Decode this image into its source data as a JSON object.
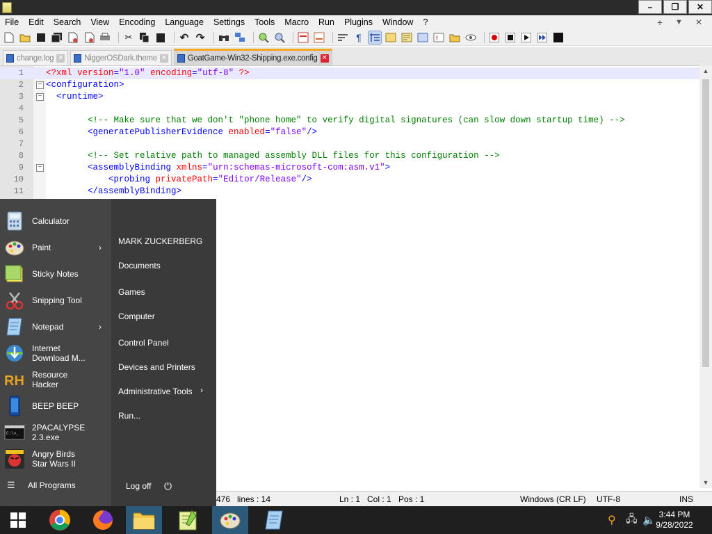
{
  "window": {
    "title": ""
  },
  "menubar": {
    "items": [
      "File",
      "Edit",
      "Search",
      "View",
      "Encoding",
      "Language",
      "Settings",
      "Tools",
      "Macro",
      "Run",
      "Plugins",
      "Window",
      "?"
    ],
    "right": [
      "+",
      "▼",
      "✕"
    ]
  },
  "window_buttons": {
    "minimize": "–",
    "restore": "❐",
    "close": "✕"
  },
  "tabs": [
    {
      "label": "change.log",
      "close": "✕"
    },
    {
      "label": "NiggerOSDark.theme",
      "close": "✕"
    },
    {
      "label": "GoatGame-Win32-Shipping.exe.config",
      "close": "✕"
    }
  ],
  "editor": {
    "lines": [
      {
        "n": "1",
        "fold": "",
        "seg": [
          [
            "pi",
            "<?xml "
          ],
          [
            "attr",
            "version"
          ],
          [
            "tag",
            "="
          ],
          [
            "val",
            "\"1.0\""
          ],
          [
            "attr",
            " encoding"
          ],
          [
            "tag",
            "="
          ],
          [
            "val",
            "\"utf-8\""
          ],
          [
            "pi",
            " ?>"
          ]
        ]
      },
      {
        "n": "2",
        "fold": "−",
        "seg": [
          [
            "tag",
            "<configuration>"
          ]
        ]
      },
      {
        "n": "3",
        "fold": "−",
        "seg": [
          [
            "tag",
            "  <runtime>"
          ]
        ]
      },
      {
        "n": "4",
        "fold": "",
        "seg": []
      },
      {
        "n": "5",
        "fold": "",
        "seg": [
          [
            "cmt",
            "        <!-- Make sure that we don't \"phone home\" to verify digital signatures (can slow down startup time) -->"
          ]
        ]
      },
      {
        "n": "6",
        "fold": "",
        "seg": [
          [
            "tag",
            "        <generatePublisherEvidence "
          ],
          [
            "attr",
            "enabled"
          ],
          [
            "tag",
            "="
          ],
          [
            "val",
            "\"false\""
          ],
          [
            "tag",
            "/>"
          ]
        ]
      },
      {
        "n": "7",
        "fold": "",
        "seg": []
      },
      {
        "n": "8",
        "fold": "",
        "seg": [
          [
            "cmt",
            "        <!-- Set relative path to managed assembly DLL files for this configuration -->"
          ]
        ]
      },
      {
        "n": "9",
        "fold": "−",
        "seg": [
          [
            "tag",
            "        <assemblyBinding "
          ],
          [
            "attr",
            "xmlns"
          ],
          [
            "tag",
            "="
          ],
          [
            "val",
            "\"urn:schemas-microsoft-com:asm.v1\""
          ],
          [
            "tag",
            ">"
          ]
        ]
      },
      {
        "n": "10",
        "fold": "",
        "seg": [
          [
            "tag",
            "            <probing "
          ],
          [
            "attr",
            "privatePath"
          ],
          [
            "tag",
            "="
          ],
          [
            "val",
            "\"Editor/Release\""
          ],
          [
            "tag",
            "/>"
          ]
        ]
      },
      {
        "n": "11",
        "fold": "",
        "seg": [
          [
            "tag",
            "        </assemblyBinding>"
          ]
        ]
      }
    ]
  },
  "statusbar": {
    "length": "476",
    "lines": "lines : 14",
    "ln": "Ln : 1",
    "col": "Col : 1",
    "pos": "Pos : 1",
    "eol": "Windows (CR LF)",
    "encoding": "UTF-8",
    "mode": "INS"
  },
  "startmenu": {
    "pinned": [
      {
        "label": "Calculator",
        "icon": "calculator-icon",
        "submenu": false
      },
      {
        "label": "Paint",
        "icon": "paint-icon",
        "submenu": true
      },
      {
        "label": "Sticky Notes",
        "icon": "sticky-notes-icon",
        "submenu": false
      },
      {
        "label": "Snipping Tool",
        "icon": "snipping-tool-icon",
        "submenu": false
      },
      {
        "label": "Notepad",
        "icon": "notepad-icon",
        "submenu": true
      },
      {
        "label": "Internet\nDownload M...",
        "icon": "idm-icon",
        "submenu": false
      },
      {
        "label": "Resource\nHacker",
        "icon": "resource-hacker-icon",
        "submenu": false
      },
      {
        "label": "BEEP BEEP",
        "icon": "phone-icon",
        "submenu": false
      },
      {
        "label": "2PACALYPSE\n2.3.exe",
        "icon": "console-icon",
        "submenu": false
      },
      {
        "label": "Angry Birds\nStar Wars II",
        "icon": "angry-birds-icon",
        "submenu": false
      }
    ],
    "all_programs": "All Programs",
    "places": [
      {
        "label": "MARK ZUCKERBERG",
        "submenu": false
      },
      {
        "label": "Documents",
        "submenu": false
      },
      {
        "label": "Games",
        "submenu": false
      },
      {
        "label": "Computer",
        "submenu": false
      },
      {
        "label": "Control Panel",
        "submenu": false
      },
      {
        "label": "Devices and Printers",
        "submenu": false
      },
      {
        "label": "Administrative Tools",
        "submenu": true
      },
      {
        "label": "Run...",
        "submenu": false
      }
    ],
    "logoff": "Log off",
    "submenu_arrow": "›"
  },
  "taskbar": {
    "time": "3:44 PM",
    "date": "9/28/2022"
  },
  "colors": {
    "accent": "#f5a623",
    "taskbar_active": "#2c5a7a",
    "startmenu_bg": "#3a3a3a"
  }
}
